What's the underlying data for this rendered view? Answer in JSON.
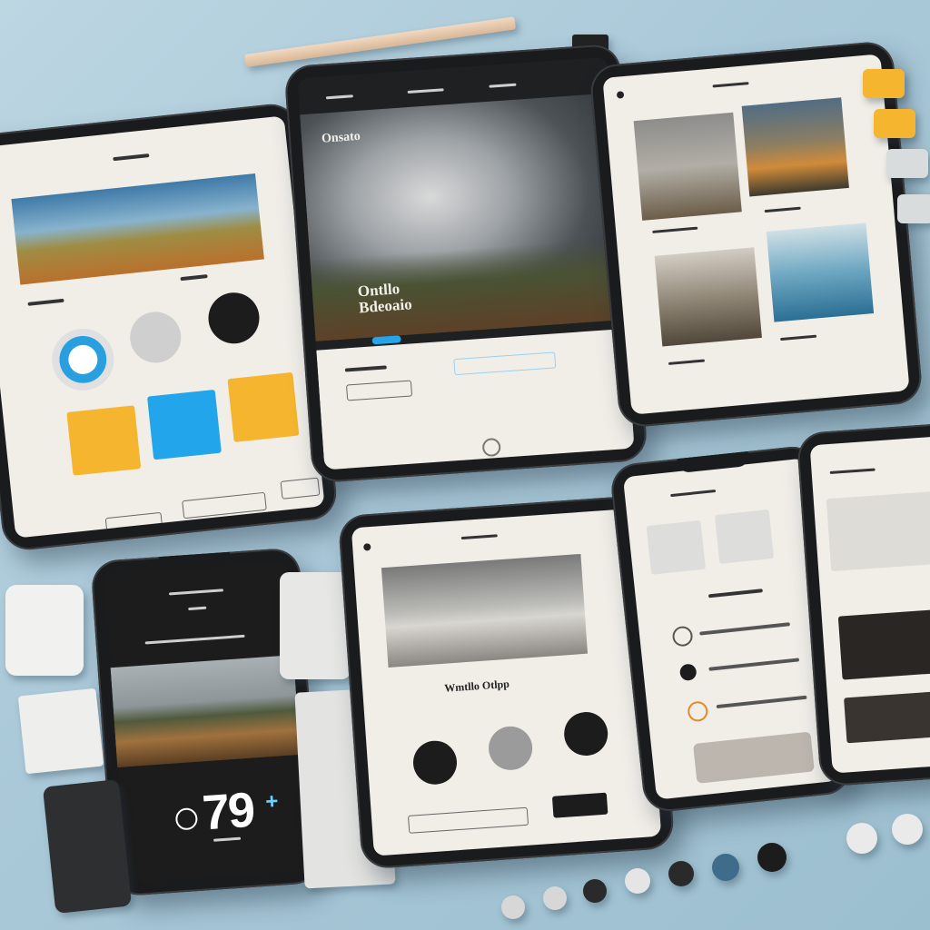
{
  "scene": {
    "background": "#a9c8d8",
    "accent_colors": {
      "yellow": "#f5b52e",
      "blue": "#22a5ea",
      "dark": "#1a1b1d",
      "cream": "#f1eee8"
    }
  },
  "tablet_hero": {
    "headline": "Ontllo\nBdeoaio",
    "brand": "Onsato"
  },
  "phone_left": {
    "counter": "79",
    "plus": "+"
  },
  "tablet_center": {
    "heading": "Wmtllo Otlpp"
  },
  "icons": [
    "settings-icon",
    "play-icon",
    "plus-icon",
    "compass-icon",
    "swap-icon"
  ]
}
